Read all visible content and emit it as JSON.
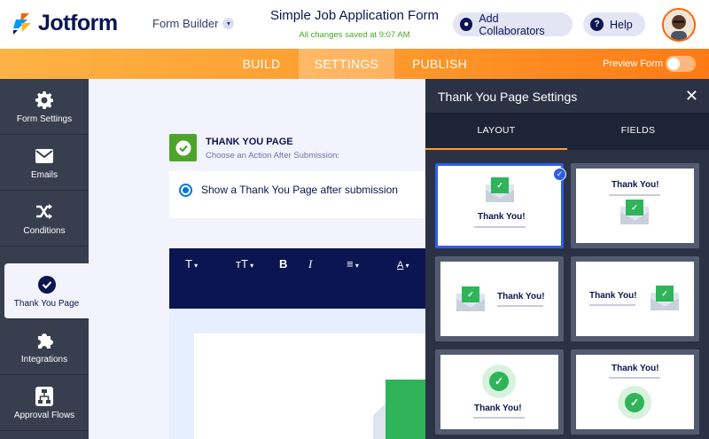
{
  "header": {
    "logo_text": "Jotform",
    "form_builder_label": "Form Builder",
    "form_title": "Simple Job Application Form",
    "save_status": "All changes saved at 9:07 AM",
    "add_collaborators_label": "Add Collaborators",
    "help_label": "Help"
  },
  "nav": {
    "tabs": [
      {
        "label": "BUILD",
        "active": false
      },
      {
        "label": "SETTINGS",
        "active": true
      },
      {
        "label": "PUBLISH",
        "active": false
      }
    ],
    "preview_label": "Preview Form",
    "preview_enabled": false
  },
  "sidebar": {
    "items": [
      {
        "label": "Form Settings",
        "icon": "gear-icon",
        "active": false
      },
      {
        "label": "Emails",
        "icon": "envelope-icon",
        "active": false
      },
      {
        "label": "Conditions",
        "icon": "shuffle-icon",
        "active": false
      },
      {
        "label": "Thank You Page",
        "icon": "check-circle-icon",
        "active": true
      },
      {
        "label": "Integrations",
        "icon": "puzzle-icon",
        "active": false
      },
      {
        "label": "Approval Flows",
        "icon": "flow-icon",
        "active": false
      }
    ]
  },
  "main": {
    "section_title": "THANK YOU PAGE",
    "section_subtitle": "Choose an Action After Submission:",
    "option_label": "Show a Thank You Page after submission",
    "toolbar": {
      "text_style": "T",
      "text_size": "ᴛT",
      "bold": "B",
      "italic": "I",
      "align": "≡",
      "color": "A"
    }
  },
  "panel": {
    "title": "Thank You Page Settings",
    "tabs": [
      {
        "label": "LAYOUT",
        "active": true
      },
      {
        "label": "FIELDS",
        "active": false
      }
    ],
    "thumbnail_text": "Thank You!",
    "selected_layout": 1
  },
  "colors": {
    "brand_orange": "#ff6100",
    "navy": "#0a1551",
    "success_green": "#2fb45a",
    "select_blue": "#2f5de8"
  }
}
